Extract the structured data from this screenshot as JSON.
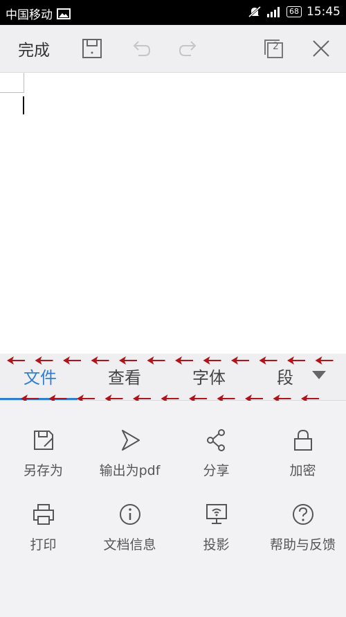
{
  "status_bar": {
    "carrier": "中国移动",
    "battery": "68",
    "time": "15:45"
  },
  "toolbar": {
    "done_label": "完成",
    "page_count": "2"
  },
  "tabs": [
    {
      "label": "文件",
      "active": true
    },
    {
      "label": "查看",
      "active": false
    },
    {
      "label": "字体",
      "active": false
    },
    {
      "label": "段",
      "active": false
    }
  ],
  "file_menu": {
    "row1": [
      {
        "label": "另存为",
        "icon": "save-as-icon"
      },
      {
        "label": "输出为pdf",
        "icon": "export-pdf-icon"
      },
      {
        "label": "分享",
        "icon": "share-icon"
      },
      {
        "label": "加密",
        "icon": "lock-icon"
      }
    ],
    "row2": [
      {
        "label": "打印",
        "icon": "print-icon"
      },
      {
        "label": "文档信息",
        "icon": "info-icon"
      },
      {
        "label": "投影",
        "icon": "projection-icon"
      },
      {
        "label": "帮助与反馈",
        "icon": "help-icon"
      }
    ]
  },
  "colors": {
    "accent": "#2e7fd1",
    "annotation_arrow": "#b0141a"
  }
}
